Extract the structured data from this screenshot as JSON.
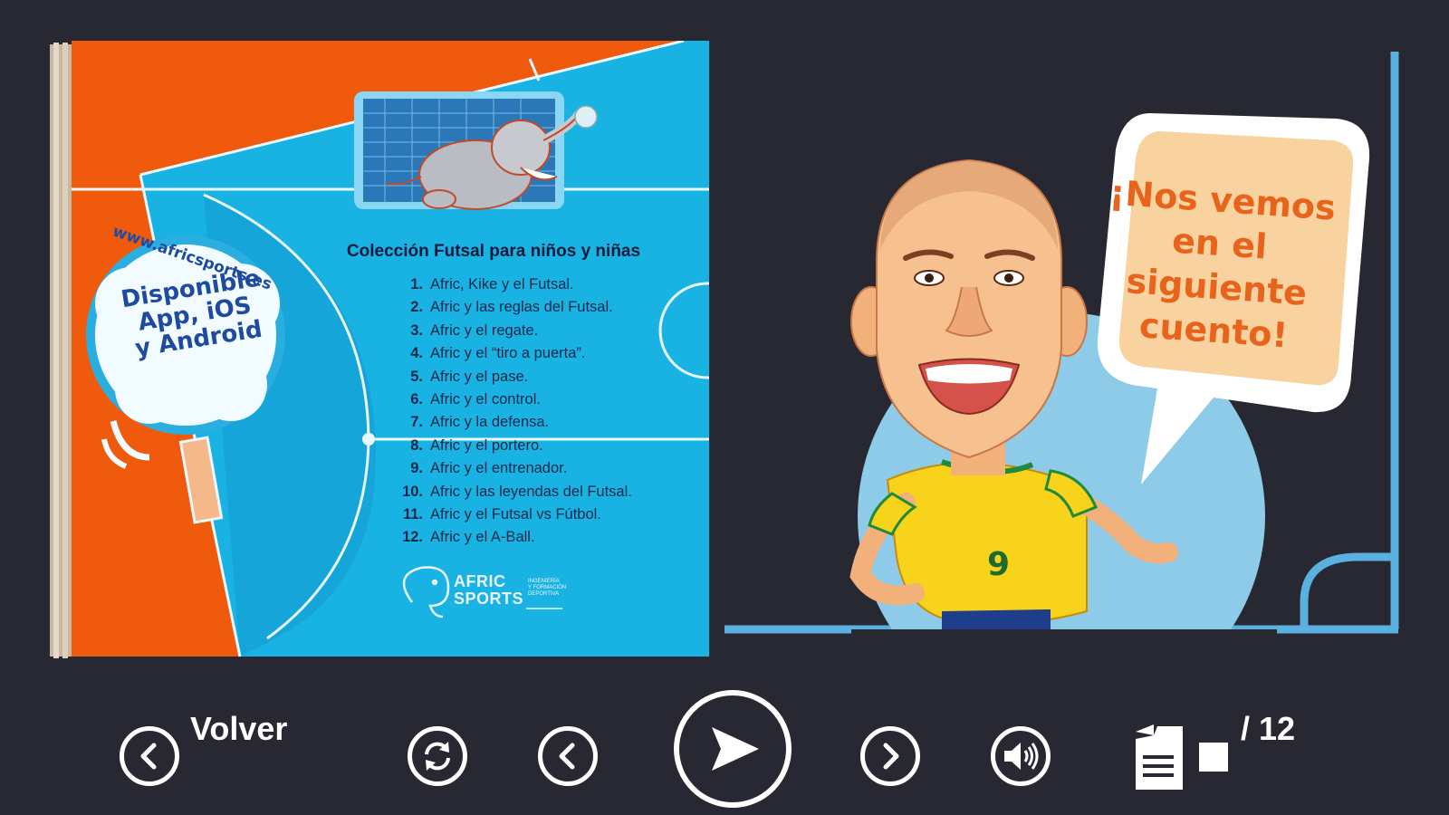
{
  "book": {
    "website": "www.africsports.es",
    "availability_lines": [
      "Disponible",
      "App, iOS",
      "y Android"
    ],
    "collection_title": "Colección Futsal para niños y niñas",
    "stories": [
      {
        "num": "1.",
        "title": "Afric, Kike y el Futsal."
      },
      {
        "num": "2.",
        "title": "Afric y las reglas del Futsal."
      },
      {
        "num": "3.",
        "title": "Afric y el regate."
      },
      {
        "num": "4.",
        "title": "Afric y el “tiro a puerta”."
      },
      {
        "num": "5.",
        "title": "Afric y el pase."
      },
      {
        "num": "6.",
        "title": "Afric y el control."
      },
      {
        "num": "7.",
        "title": "Afric y la defensa."
      },
      {
        "num": "8.",
        "title": "Afric y el portero."
      },
      {
        "num": "9.",
        "title": "Afric y el entrenador."
      },
      {
        "num": "10.",
        "title": "Afric y las leyendas del Futsal."
      },
      {
        "num": "11.",
        "title": "Afric y el Futsal vs Fútbol."
      },
      {
        "num": "12.",
        "title": "Afric y el A-Ball."
      }
    ],
    "brand_name_lines": [
      "AFRIC",
      "SPORTS"
    ],
    "brand_sub_lines": [
      "INGENIERÍA",
      "Y FORMACIÓN",
      "DEPORTIVA"
    ]
  },
  "panel": {
    "bubble_lines": [
      "¡Nos vemos",
      "en el",
      "siguiente",
      "cuento!"
    ],
    "player_number": "9"
  },
  "controls": {
    "back_label": "Volver",
    "page_total": "/ 12",
    "icons": [
      "back-icon",
      "replay-icon",
      "previous-icon",
      "play-icon",
      "next-icon",
      "volume-icon",
      "pages-icon"
    ]
  },
  "colors": {
    "background": "#272832",
    "court_blue": "#19b3e3",
    "court_orange": "#f05a0c",
    "panel_line": "#5ab1e0",
    "bubble_text": "#e8641c",
    "bubble_fill": "#f8d3a0",
    "jersey": "#f7d31b"
  }
}
